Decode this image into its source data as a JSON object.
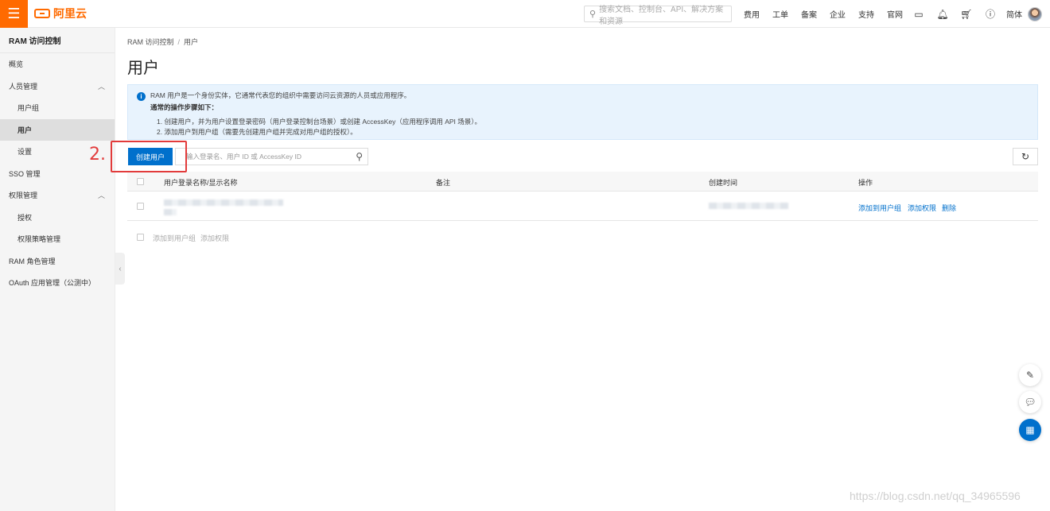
{
  "topbar": {
    "brand": "阿里云",
    "search_placeholder": "搜索文档、控制台、API、解决方案和资源",
    "nav": [
      "费用",
      "工单",
      "备案",
      "企业",
      "支持",
      "官网"
    ],
    "lang": "简体",
    "icons": [
      "terminal-icon",
      "bell-icon",
      "cart-icon",
      "help-icon"
    ]
  },
  "sidebar": {
    "title": "RAM 访问控制",
    "items": [
      {
        "label": "概览"
      },
      {
        "label": "人员管理"
      },
      {
        "label": "用户组"
      },
      {
        "label": "用户"
      },
      {
        "label": "设置"
      },
      {
        "label": "SSO 管理"
      },
      {
        "label": "权限管理"
      },
      {
        "label": "授权"
      },
      {
        "label": "权限策略管理"
      },
      {
        "label": "RAM 角色管理"
      },
      {
        "label": "OAuth 应用管理（公测中）"
      }
    ]
  },
  "main": {
    "breadcrumb": [
      "RAM 访问控制",
      "用户"
    ],
    "title": "用户",
    "notice": {
      "line1": "RAM 用户是一个身份实体，它通常代表您的组织中需要访问云资源的人员或应用程序。",
      "line2": "通常的操作步骤如下：",
      "line3": "1. 创建用户，并为用户设置登录密码（用户登录控制台场景）或创建 AccessKey（应用程序调用 API 场景）。",
      "line4": "2. 添加用户到用户组（需要先创建用户组并完成对用户组的授权）。"
    },
    "create_button": "创建用户",
    "search_placeholder": "输入登录名、用户 ID 或 AccessKey ID",
    "table": {
      "headers": [
        "用户登录名称/显示名称",
        "备注",
        "创建时间",
        "操作"
      ],
      "row_actions": [
        "添加到用户组",
        "添加权限",
        "删除"
      ]
    },
    "batch_actions": [
      "添加到用户组",
      "添加权限"
    ]
  },
  "annotation": {
    "step": "2.",
    "color": "#e23b3b"
  },
  "watermark": "https://blog.csdn.net/qq_34965596",
  "colors": {
    "brand": "#ff6a00",
    "primary": "#0070cc"
  }
}
